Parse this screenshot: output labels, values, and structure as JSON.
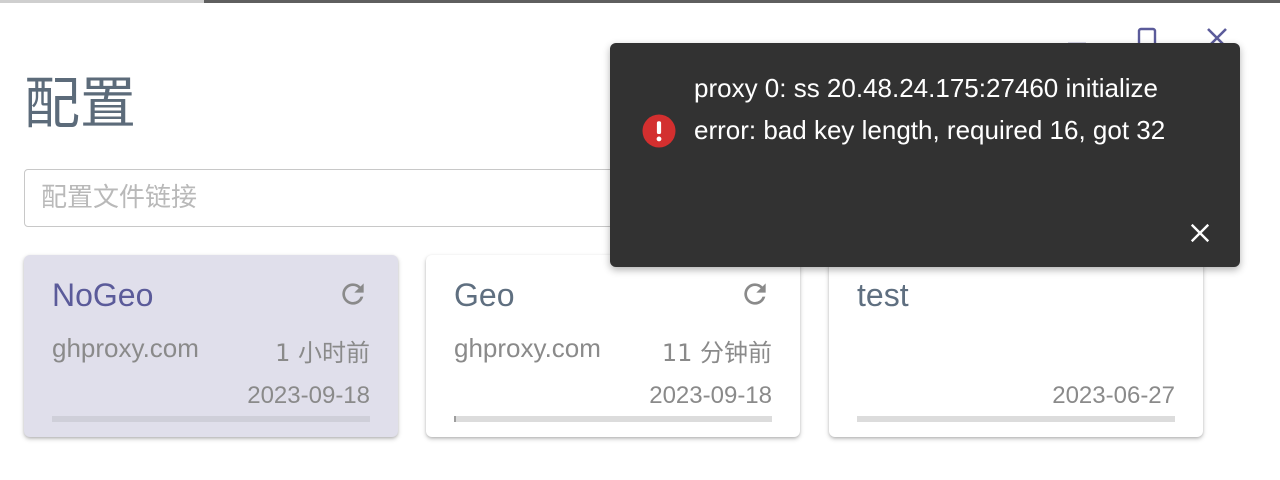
{
  "page": {
    "title": "配置",
    "search_placeholder": "配置文件链接"
  },
  "profiles": [
    {
      "name": "NoGeo",
      "host": "ghproxy.com",
      "updated": "1 小时前",
      "date": "2023-09-18",
      "progress": 0.0,
      "selected": true,
      "refreshable": true
    },
    {
      "name": "Geo",
      "host": "ghproxy.com",
      "updated": "11 分钟前",
      "date": "2023-09-18",
      "progress": 0.005,
      "selected": false,
      "refreshable": true
    },
    {
      "name": "test",
      "host": "",
      "updated": "",
      "date": "2023-06-27",
      "progress": 0.0,
      "selected": false,
      "refreshable": false
    }
  ],
  "toast": {
    "message": "proxy 0: ss 20.48.24.175:27460 initialize error: bad key length, required 16, got 32",
    "icon": "error-icon",
    "icon_color": "#d32f2f"
  },
  "colors": {
    "accent": "#5b5b9a",
    "selected_card_bg": "#e0dfeb",
    "toast_bg": "#323232"
  },
  "window_controls": [
    "minimize-icon",
    "maximize-icon",
    "close-icon"
  ]
}
